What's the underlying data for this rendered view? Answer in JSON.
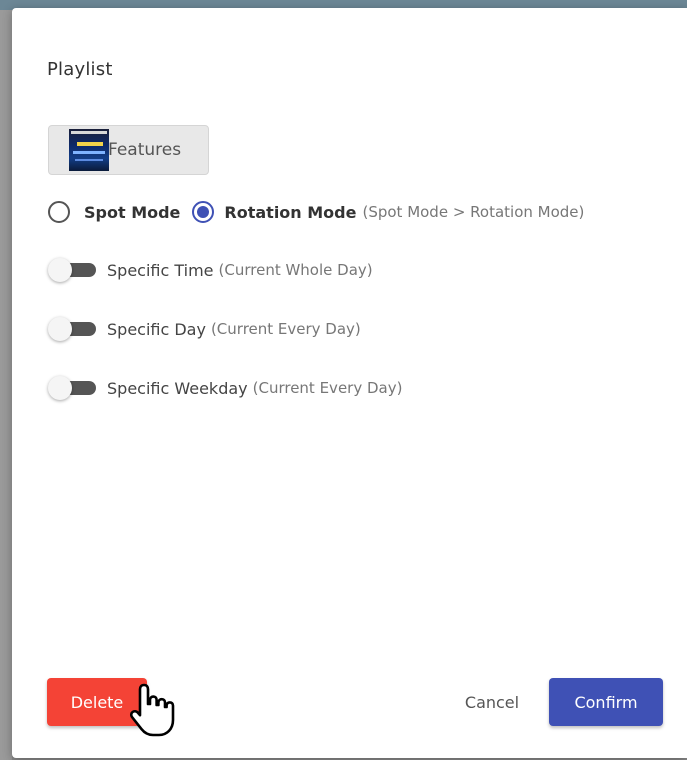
{
  "dialog": {
    "title": "Playlist"
  },
  "playlist_chip": {
    "label": "Features",
    "thumbnail_icon": "las-vegas-thumbnail-icon"
  },
  "modes": {
    "options": [
      {
        "label": "Spot Mode",
        "checked": false
      },
      {
        "label": "Rotation Mode",
        "checked": true
      }
    ],
    "note": "(Spot Mode > Rotation Mode)"
  },
  "toggles": [
    {
      "label": "Specific Time",
      "note": "(Current Whole Day)",
      "on": false
    },
    {
      "label": "Specific Day",
      "note": "(Current Every Day)",
      "on": false
    },
    {
      "label": "Specific Weekday",
      "note": "(Current Every Day)",
      "on": false
    }
  ],
  "actions": {
    "delete_label": "Delete",
    "cancel_label": "Cancel",
    "confirm_label": "Confirm"
  },
  "colors": {
    "primary": "#3f51b5",
    "danger": "#f44336",
    "toggle_track": "#555555"
  },
  "icons": {
    "cursor": "hand-pointer-icon"
  }
}
